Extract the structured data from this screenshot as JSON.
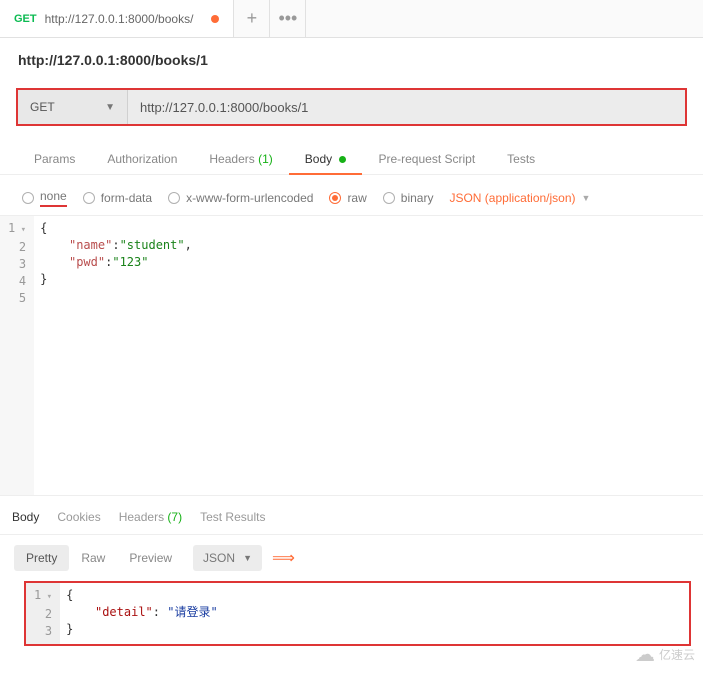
{
  "tab": {
    "method": "GET",
    "url": "http://127.0.0.1:8000/books/"
  },
  "title": "http://127.0.0.1:8000/books/1",
  "urlbar": {
    "method": "GET",
    "url": "http://127.0.0.1:8000/books/1"
  },
  "reqtabs": {
    "params": "Params",
    "auth": "Authorization",
    "headers": "Headers",
    "headers_count": "(1)",
    "body": "Body",
    "prereq": "Pre-request Script",
    "tests": "Tests"
  },
  "bodytypes": {
    "none": "none",
    "form": "form-data",
    "urlenc": "x-www-form-urlencoded",
    "raw": "raw",
    "binary": "binary",
    "jsontype": "JSON (application/json)"
  },
  "reqbody": {
    "l1": "{",
    "l2_k": "\"name\"",
    "l2_s": "\"student\"",
    "l3_k": "\"pwd\"",
    "l3_s": "\"123\"",
    "l4": "}",
    "l5": ""
  },
  "resptabs": {
    "body": "Body",
    "cookies": "Cookies",
    "headers": "Headers",
    "headers_count": "(7)",
    "tests": "Test Results"
  },
  "viewbar": {
    "pretty": "Pretty",
    "raw": "Raw",
    "preview": "Preview",
    "fmt": "JSON"
  },
  "respbody": {
    "l1": "{",
    "l2_k": "\"detail\"",
    "l2_s": "\"请登录\"",
    "l3": "}"
  },
  "watermark": "亿速云"
}
